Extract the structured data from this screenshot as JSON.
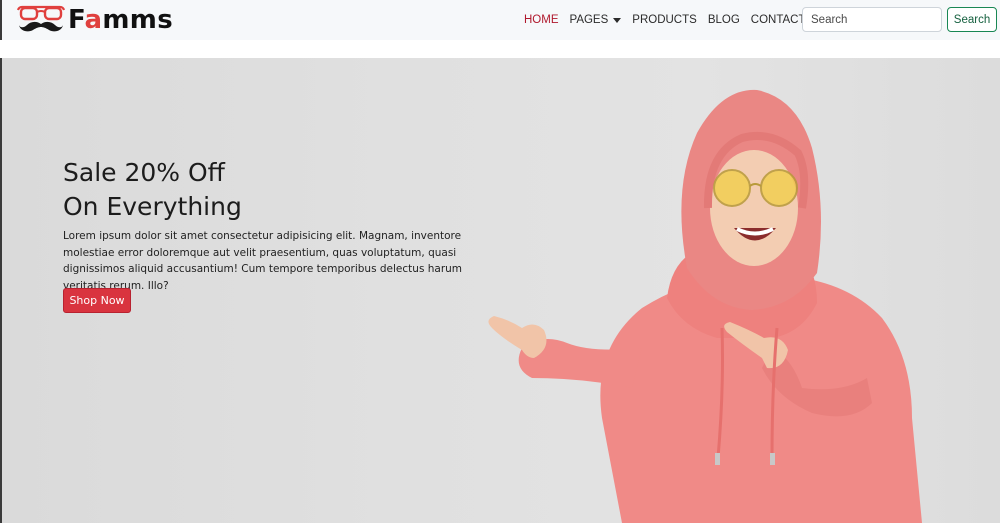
{
  "brand": {
    "name_start": "F",
    "name_accent": "a",
    "name_end": "mms",
    "accent_color": "#e0403e"
  },
  "nav": {
    "home": "HOME",
    "pages": "PAGES",
    "products": "PRODUCTS",
    "blog": "BLOG",
    "contact": "CONTACT",
    "active_color": "#b0192d"
  },
  "search": {
    "placeholder": "Search",
    "button_label": "Search"
  },
  "hero": {
    "title_line1": "Sale 20% Off",
    "title_line2": "On Everything",
    "description": "Lorem ipsum dolor sit amet consectetur adipisicing elit. Magnam, inventore molestiae error doloremque aut velit praesentium, quas voluptatum, quasi dignissimos aliquid accusantium! Cum tempore temporibus delectus harum veritatis rerum. Illo?",
    "button_label": "Shop Now",
    "button_color": "#d9343f"
  },
  "icons": {
    "logo": "glasses-mustache-icon",
    "dropdown": "caret-down-icon",
    "cart": "shopping-cart-icon"
  }
}
